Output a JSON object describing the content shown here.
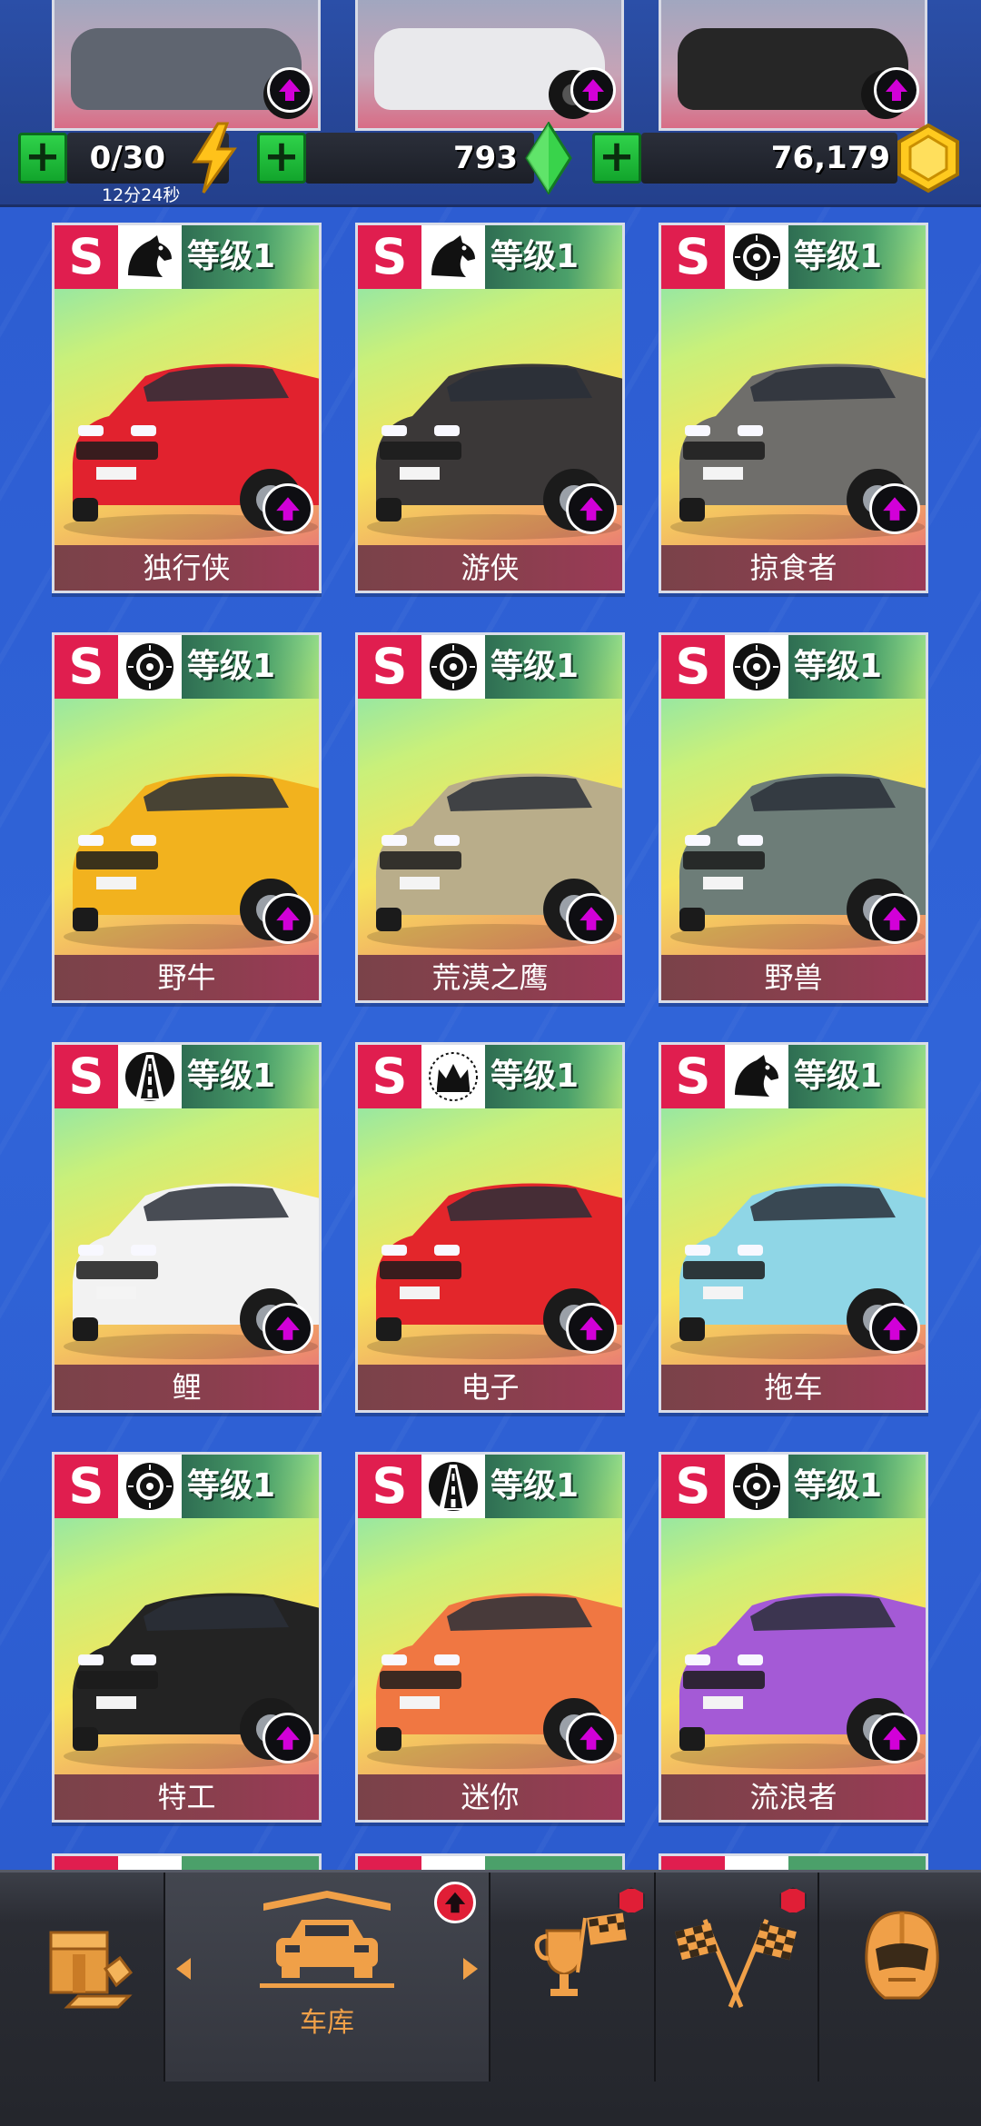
{
  "resources": {
    "energy": "0/30",
    "energy_timer": "12分24秒",
    "gems": "793",
    "coins": "76,179"
  },
  "cards": [
    {
      "rarity": "S",
      "class_icon": "horse-icon",
      "level": "等级1",
      "name": "独行侠",
      "color": "#e1222e"
    },
    {
      "rarity": "S",
      "class_icon": "horse-icon",
      "level": "等级1",
      "name": "游侠",
      "color": "#3b3838"
    },
    {
      "rarity": "S",
      "class_icon": "tire-icon",
      "level": "等级1",
      "name": "掠食者",
      "color": "#6f6e6b"
    },
    {
      "rarity": "S",
      "class_icon": "tire-icon",
      "level": "等级1",
      "name": "野牛",
      "color": "#f2b21e"
    },
    {
      "rarity": "S",
      "class_icon": "tire-icon",
      "level": "等级1",
      "name": "荒漠之鹰",
      "color": "#b9ad8a"
    },
    {
      "rarity": "S",
      "class_icon": "tire-icon",
      "level": "等级1",
      "name": "野兽",
      "color": "#6d7d78"
    },
    {
      "rarity": "S",
      "class_icon": "road-icon",
      "level": "等级1",
      "name": "鲤",
      "color": "#f2f2f2"
    },
    {
      "rarity": "S",
      "class_icon": "crown-icon",
      "level": "等级1",
      "name": "电子",
      "color": "#e3262b"
    },
    {
      "rarity": "S",
      "class_icon": "horse-icon",
      "level": "等级1",
      "name": "拖车",
      "color": "#8fd6e6"
    },
    {
      "rarity": "S",
      "class_icon": "tire-icon",
      "level": "等级1",
      "name": "特工",
      "color": "#232323"
    },
    {
      "rarity": "S",
      "class_icon": "road-icon",
      "level": "等级1",
      "name": "迷你",
      "color": "#f07742"
    },
    {
      "rarity": "S",
      "class_icon": "tire-icon",
      "level": "等级1",
      "name": "流浪者",
      "color": "#a45ad6"
    }
  ],
  "nav": {
    "shop_icon": "shop-crate-icon",
    "garage_label": "车库",
    "events_icon": "trophy-flag-icon",
    "race_icon": "checkered-flags-icon",
    "profile_icon": "helmet-icon"
  },
  "colors": {
    "accent": "#f0a048",
    "rarity_s": "#e01e4f",
    "upgrade": "#d200d8",
    "plus": "#1fbf3b",
    "notification": "#e01e36"
  }
}
